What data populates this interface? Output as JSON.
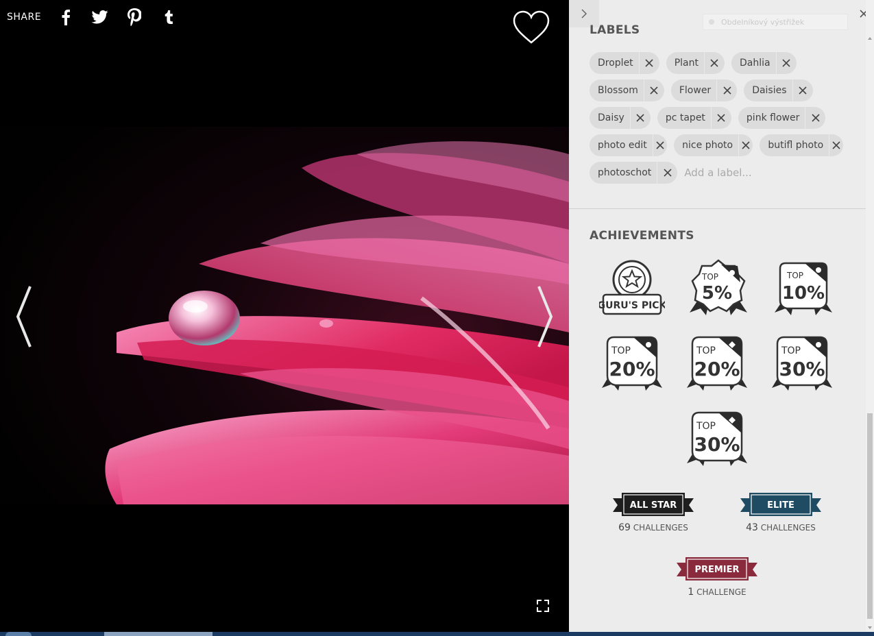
{
  "share": {
    "label": "SHARE",
    "icons": [
      "facebook-icon",
      "twitter-icon",
      "pinterest-icon",
      "tumblr-icon"
    ]
  },
  "viewer": {
    "favorite_icon": "heart-icon",
    "prev_icon": "chevron-left-icon",
    "next_icon": "chevron-right-icon",
    "fullscreen_icon": "fullscreen-icon"
  },
  "panel": {
    "snip_tooltip": "Obdelníkový výstřižek",
    "labels_title": "LABELS",
    "labels": [
      [
        "Droplet",
        "Plant",
        "Dahlia"
      ],
      [
        "Blossom",
        "Flower",
        "Daisies"
      ],
      [
        "Daisy",
        "pc tapet",
        "pink flower"
      ],
      [
        "photo edit",
        "nice photo",
        "butifl photo"
      ],
      [
        "photoschot"
      ]
    ],
    "add_label_placeholder": "Add a label...",
    "achievements_title": "ACHIEVEMENTS",
    "badges": [
      {
        "kind": "gurus-pick",
        "line1": "GURU'S PICK"
      },
      {
        "kind": "top",
        "top": "TOP",
        "pct": "5%"
      },
      {
        "kind": "top",
        "top": "TOP",
        "pct": "10%"
      },
      {
        "kind": "top",
        "top": "TOP",
        "pct": "20%"
      },
      {
        "kind": "top",
        "top": "TOP",
        "pct": "20%"
      },
      {
        "kind": "top",
        "top": "TOP",
        "pct": "30%"
      },
      {
        "kind": "top",
        "top": "TOP",
        "pct": "30%"
      }
    ],
    "ribbons": {
      "allstar": {
        "label": "ALL STAR",
        "count": "69",
        "unit": "CHALLENGES",
        "color": "#1e1e1e"
      },
      "elite": {
        "label": "ELITE",
        "count": "43",
        "unit": "CHALLENGES",
        "color": "#1f4b63"
      },
      "premier": {
        "label": "PREMIER",
        "count": "1",
        "unit": "CHALLENGE",
        "color": "#8a2a3d"
      }
    }
  },
  "colors": {
    "panel_bg": "#ececec",
    "chip_bg": "#dcdcdc",
    "petal": "#e0407a"
  }
}
